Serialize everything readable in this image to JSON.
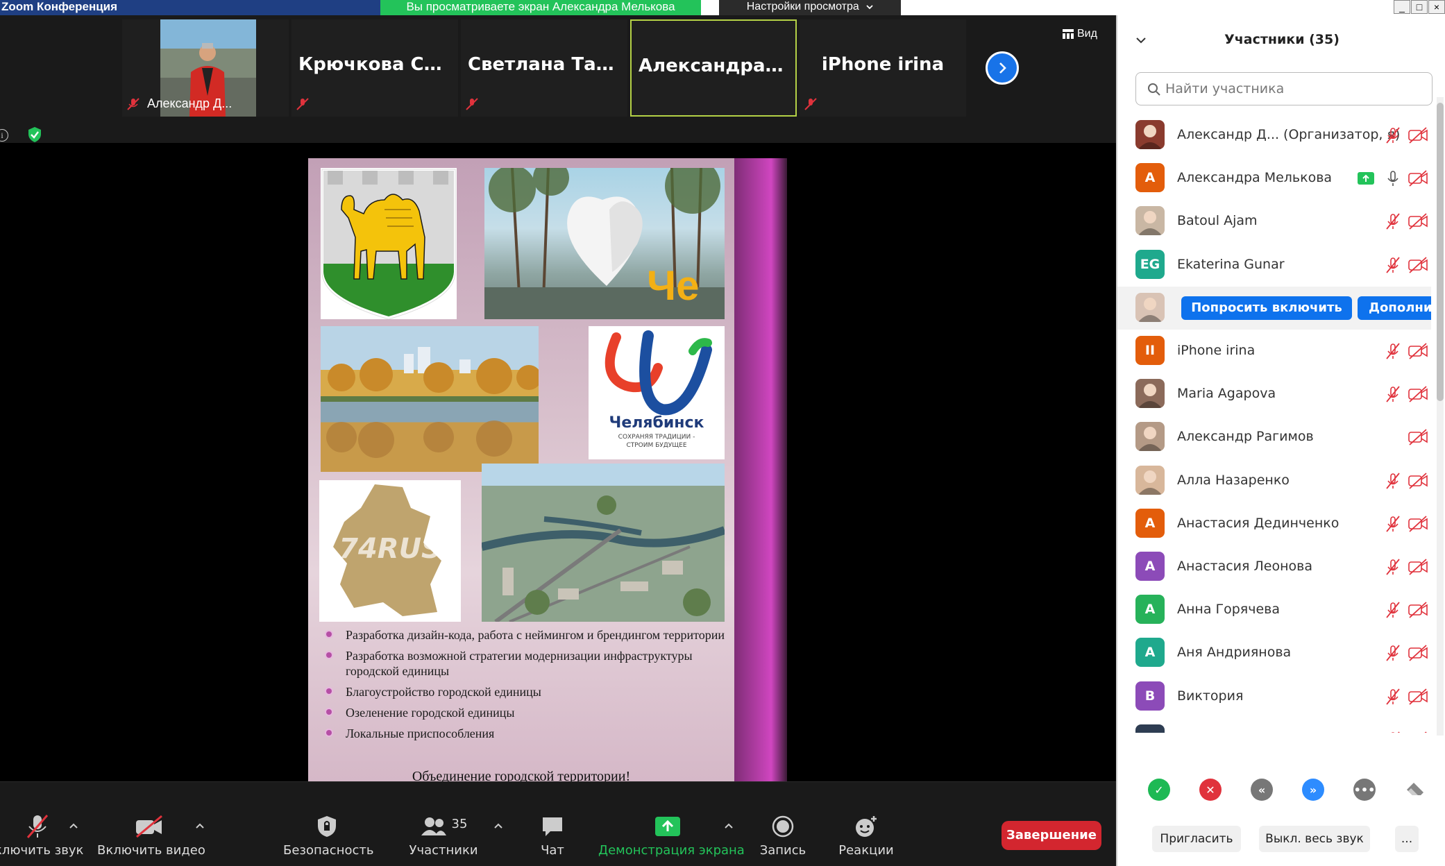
{
  "window": {
    "title": "Zoom Конференция",
    "share_banner": "Вы просматриваете экран Александра Мелькова",
    "view_settings": "Настройки просмотра"
  },
  "thumbnails": [
    {
      "name": "Александр Д...",
      "has_video": true
    },
    {
      "name": "Крючкова  Соф..."
    },
    {
      "name": "Светлана Тазина"
    },
    {
      "name": "Александра  М...",
      "active": true
    },
    {
      "name": "iPhone irina"
    }
  ],
  "view_button": "Вид",
  "slide": {
    "logo_city": "Челябинск",
    "logo_tagline_1": "СОХРАНЯЯ ТРАДИЦИИ -",
    "logo_tagline_2": "СТРОИМ БУДУЩЕЕ",
    "region_label": "74RUS",
    "heart_letters": "Че",
    "bullets": [
      "Разработка дизайн-кода, работа с неймингом и брендингом территории",
      "Разработка возможной стратегии модернизации инфраструктуры городской единицы",
      "Благоустройство городской единицы",
      "Озеленение городской единицы",
      "Локальные приспособления"
    ],
    "footer": "Объединение городской территории!"
  },
  "toolbar": {
    "audio": "ключить звук",
    "video": "Включить видео",
    "security": "Безопасность",
    "participants": "Участники",
    "participants_count": "35",
    "chat": "Чат",
    "share": "Демонстрация экрана",
    "record": "Запись",
    "reactions": "Реакции",
    "end": "Завершение"
  },
  "panel": {
    "title": "Участники (35)",
    "search_placeholder": "Найти участника",
    "participants": [
      {
        "name": "Александр Д...  (Организатор, я)",
        "avatar": "photo",
        "avatar_color": "#8a3b2e",
        "mic": "muted",
        "cam": "off"
      },
      {
        "name": "Александра Мелькова",
        "avatar": "А",
        "avatar_color": "#e35d0b",
        "sharing": true,
        "mic": "on",
        "cam": "off"
      },
      {
        "name": "Batoul Ajam",
        "avatar": "photo",
        "avatar_color": "#c9b7a4",
        "mic": "muted",
        "cam": "off"
      },
      {
        "name": "Ekaterina Gunar",
        "avatar": "EG",
        "avatar_color": "#1fa98d",
        "mic": "muted",
        "cam": "off"
      },
      {
        "name": "",
        "avatar": "photo",
        "avatar_color": "#d9c3b5",
        "hover": true
      },
      {
        "name": "iPhone irina",
        "avatar": "II",
        "avatar_color": "#e35d0b",
        "mic": "muted",
        "cam": "off"
      },
      {
        "name": "Maria Agapova",
        "avatar": "photo",
        "avatar_color": "#8b6a5a",
        "mic": "muted",
        "cam": "off"
      },
      {
        "name": "Александр Рагимов",
        "avatar": "photo",
        "avatar_color": "#b49a86",
        "mic": "none",
        "cam": "off"
      },
      {
        "name": "Алла Назаренко",
        "avatar": "photo",
        "avatar_color": "#d8b79b",
        "mic": "muted",
        "cam": "off"
      },
      {
        "name": "Анастасия Дединченко",
        "avatar": "А",
        "avatar_color": "#e35d0b",
        "mic": "muted",
        "cam": "off"
      },
      {
        "name": "Анастасия Леонова",
        "avatar": "А",
        "avatar_color": "#8c4bb8",
        "mic": "muted",
        "cam": "off"
      },
      {
        "name": "Анна Горячева",
        "avatar": "А",
        "avatar_color": "#27b25a",
        "mic": "muted",
        "cam": "off"
      },
      {
        "name": "Аня Андриянова",
        "avatar": "А",
        "avatar_color": "#1fa98d",
        "mic": "muted",
        "cam": "off"
      },
      {
        "name": "Виктория",
        "avatar": "В",
        "avatar_color": "#8c4bb8",
        "mic": "muted",
        "cam": "off"
      },
      {
        "name": "",
        "avatar": "В",
        "avatar_color": "#2e3d52",
        "mic": "muted",
        "cam": "off"
      }
    ],
    "hover_actions": {
      "ask": "Попросить включить",
      "more": "Дополни"
    },
    "invite": "Пригласить",
    "mute_all": "Выкл. весь звук",
    "more": "..."
  },
  "colors": {
    "accent": "#0e72ed",
    "share_green": "#23c35a",
    "end_red": "#d3262f",
    "muted_red": "#e0323c"
  }
}
